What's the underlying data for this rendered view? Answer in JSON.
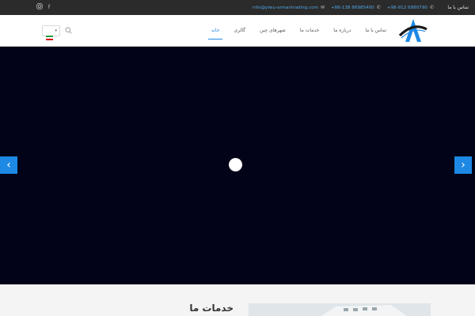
{
  "topbar": {
    "social": [
      "instagram-icon",
      "facebook-icon"
    ],
    "email": "info@yiwu-armantrading.com",
    "phone1": "+86-138 86985400",
    "phone2": "+98-912 6880790",
    "contact_label": "تماس با ما"
  },
  "nav": {
    "items": [
      "خانه",
      "گالری",
      "شهرهای چین",
      "خدمات ما",
      "درباره ما",
      "تماس با ما"
    ],
    "active_index": 0,
    "language_flag": "iran-flag"
  },
  "hero": {
    "background": "#020318",
    "accent": "#1e88e5"
  },
  "services": {
    "title": "خدمات ما"
  }
}
